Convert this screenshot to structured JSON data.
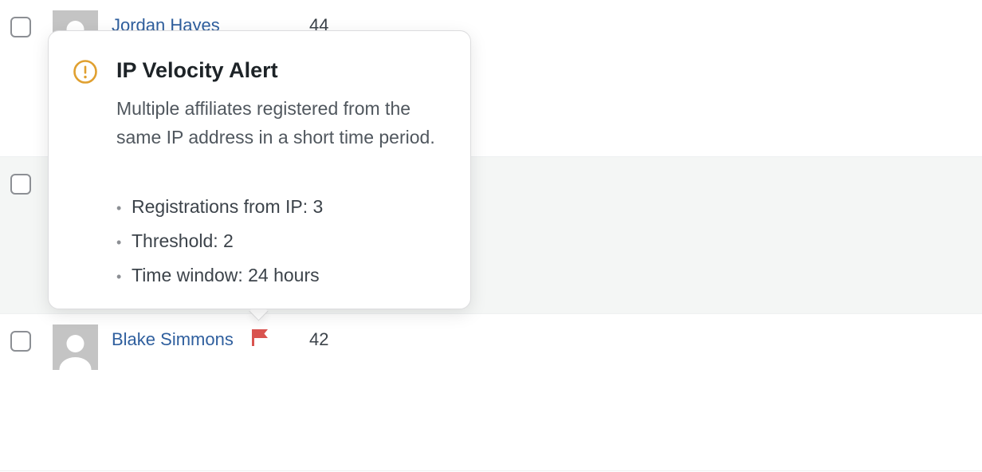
{
  "rows": [
    {
      "name": "Jordan Hayes",
      "count": "44",
      "flagged": false
    },
    {
      "name": "",
      "count": "",
      "flagged": false
    },
    {
      "name": "Blake Simmons",
      "count": "42",
      "flagged": true
    }
  ],
  "tooltip": {
    "title": "IP Velocity Alert",
    "description": "Multiple affiliates registered from the same IP address in a short time period.",
    "details": [
      "Registrations from IP: 3",
      "Threshold: 2",
      "Time window: 24 hours"
    ],
    "icon": "alert-circle-icon"
  },
  "colors": {
    "link": "#2f5f9e",
    "flag": "#d9534f",
    "alert_icon": "#e0a030",
    "row_alt_bg": "#f4f6f5"
  },
  "icons": {
    "flag": "flag-icon",
    "avatar": "default-avatar"
  }
}
